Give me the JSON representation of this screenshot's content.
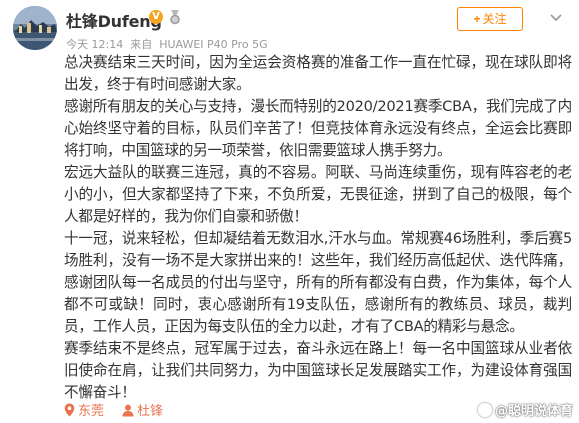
{
  "header": {
    "username": "杜锋Dufeng",
    "verified_badge": "V",
    "time": "今天 12:14",
    "source_prefix": "来自",
    "source_device": "HUAWEI P40 Pro 5G",
    "follow_label": "关注",
    "follow_plus": "+",
    "avatar_icon": "avatar-photo",
    "medal_icon": "medal-icon",
    "more_icon": "chevron-down-icon"
  },
  "post": {
    "paragraphs": [
      "总决赛结束三天时间，因为全运会资格赛的准备工作一直在忙碌，现在球队即将出发，终于有时间感谢大家。",
      "感谢所有朋友的关心与支持，漫长而特别的2020/2021赛季CBA，我们完成了内心始终坚守着的目标，队员们辛苦了！但竞技体育永远没有终点，全运会比赛即将打响，中国篮球的另一项荣誉，依旧需要篮球人携手努力。",
      "宏远大益队的联赛三连冠，真的不容易。阿联、马尚连续重伤，现有阵容老的老小的小，但大家都坚持了下来，不负所爱，无畏征途，拼到了自己的极限，每个人都是好样的，我为你们自豪和骄傲！",
      "十一冠，说来轻松，但却凝结着无数泪水,汗水与血。常规赛46场胜利，季后赛5场胜利，没有一场不是大家拼出来的！这些年，我们经历高低起伏、迭代阵痛，感谢团队每一名成员的付出与坚守，所有的所有都没有白费，作为集体，每个人都不可或缺！同时，衷心感谢所有19支队伍，感谢所有的教练员、球员，裁判员，工作人员，正因为每支队伍的全力以赴，才有了CBA的精彩与悬念。",
      "赛季结束不是终点，冠军属于过去，奋斗永远在路上！每一名中国篮球从业者依旧使命在肩，让我们共同努力，为中国篮球长足发展踏实工作，为建设体育强国不懈奋斗！"
    ]
  },
  "footer": {
    "location": "东莞",
    "mention": "杜锋",
    "location_icon": "location-pin-icon",
    "user_icon": "user-icon"
  },
  "watermark": {
    "text": "@聪明说体育"
  },
  "colors": {
    "accent": "#ff8200",
    "link": "#eb7350",
    "text": "#333333",
    "meta": "#9a9a9a",
    "badge": "#f4a623"
  }
}
